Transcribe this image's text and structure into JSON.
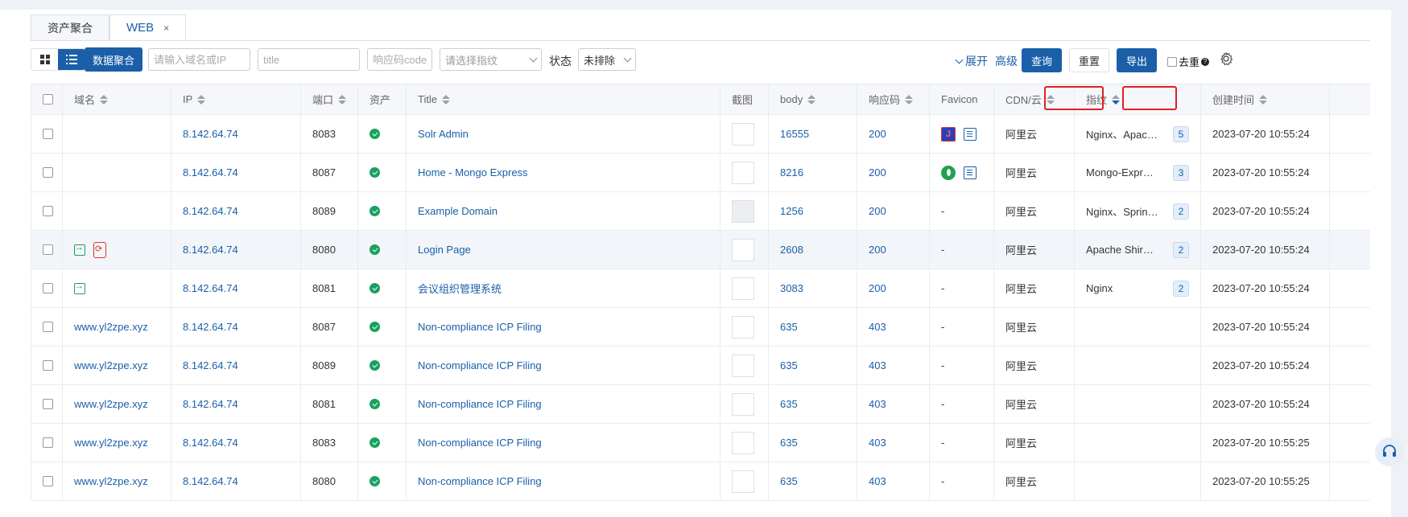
{
  "tabs": [
    {
      "label": "资产聚合"
    },
    {
      "label": "WEB",
      "close": "×"
    }
  ],
  "toolbar": {
    "aggregate_button": "数据聚合",
    "search_placeholder": "请输入域名或IP",
    "title_placeholder": "title",
    "code_placeholder": "响应码code",
    "fingerprint_placeholder": "请选择指纹",
    "status_label": "状态",
    "status_value": "未排除",
    "expand_label": "展开",
    "advanced_label": "高级",
    "query_button": "查询",
    "reset_button": "重置",
    "export_button": "导出",
    "dedup_label": "去重",
    "dedup_help": "?"
  },
  "table": {
    "headers": [
      "域名",
      "IP",
      "端口",
      "资产",
      "Title",
      "截图",
      "body",
      "响应码",
      "Favicon",
      "CDN/云",
      "指纹",
      "创建时间"
    ],
    "rows": [
      {
        "domain": "",
        "ip": "8.142.64.74",
        "port": "8083",
        "title": "Solr Admin",
        "body": "16555",
        "code": "200",
        "favicon": "solr",
        "cdn": "阿里云",
        "fingerprint": "Nginx、Apac…",
        "fp_count": "5",
        "created": "2023-07-20 10:55:24"
      },
      {
        "domain": "",
        "ip": "8.142.64.74",
        "port": "8087",
        "title": "Home - Mongo Express",
        "body": "8216",
        "code": "200",
        "favicon": "mongo",
        "cdn": "阿里云",
        "fingerprint": "Mongo-Expr…",
        "fp_count": "3",
        "created": "2023-07-20 10:55:24"
      },
      {
        "domain": "",
        "ip": "8.142.64.74",
        "port": "8089",
        "title": "Example Domain",
        "body": "1256",
        "code": "200",
        "favicon": "-",
        "cdn": "阿里云",
        "fingerprint": "Nginx、Sprin…",
        "fp_count": "2",
        "created": "2023-07-20 10:55:24"
      },
      {
        "domain": "",
        "ip": "8.142.64.74",
        "port": "8080",
        "title": "Login Page",
        "body": "2608",
        "code": "200",
        "favicon": "-",
        "cdn": "阿里云",
        "fingerprint": "Apache Shir…",
        "fp_count": "2",
        "created": "2023-07-20 10:55:24"
      },
      {
        "domain": "",
        "ip": "8.142.64.74",
        "port": "8081",
        "title": "会议组织管理系统",
        "body": "3083",
        "code": "200",
        "favicon": "-",
        "cdn": "阿里云",
        "fingerprint": "Nginx",
        "fp_count": "2",
        "created": "2023-07-20 10:55:24"
      },
      {
        "domain": "www.yl2zpe.xyz",
        "ip": "8.142.64.74",
        "port": "8087",
        "title": "Non-compliance ICP Filing",
        "body": "635",
        "code": "403",
        "favicon": "-",
        "cdn": "阿里云",
        "fingerprint": "",
        "fp_count": "",
        "created": "2023-07-20 10:55:24"
      },
      {
        "domain": "www.yl2zpe.xyz",
        "ip": "8.142.64.74",
        "port": "8089",
        "title": "Non-compliance ICP Filing",
        "body": "635",
        "code": "403",
        "favicon": "-",
        "cdn": "阿里云",
        "fingerprint": "",
        "fp_count": "",
        "created": "2023-07-20 10:55:24"
      },
      {
        "domain": "www.yl2zpe.xyz",
        "ip": "8.142.64.74",
        "port": "8081",
        "title": "Non-compliance ICP Filing",
        "body": "635",
        "code": "403",
        "favicon": "-",
        "cdn": "阿里云",
        "fingerprint": "",
        "fp_count": "",
        "created": "2023-07-20 10:55:24"
      },
      {
        "domain": "www.yl2zpe.xyz",
        "ip": "8.142.64.74",
        "port": "8083",
        "title": "Non-compliance ICP Filing",
        "body": "635",
        "code": "403",
        "favicon": "-",
        "cdn": "阿里云",
        "fingerprint": "",
        "fp_count": "",
        "created": "2023-07-20 10:55:25"
      },
      {
        "domain": "www.yl2zpe.xyz",
        "ip": "8.142.64.74",
        "port": "8080",
        "title": "Non-compliance ICP Filing",
        "body": "635",
        "code": "403",
        "favicon": "-",
        "cdn": "阿里云",
        "fingerprint": "",
        "fp_count": "",
        "created": "2023-07-20 10:55:25"
      }
    ]
  },
  "colors": {
    "primary": "#1a5fa8",
    "ok": "#19a15f",
    "highlight": "#e02020"
  }
}
